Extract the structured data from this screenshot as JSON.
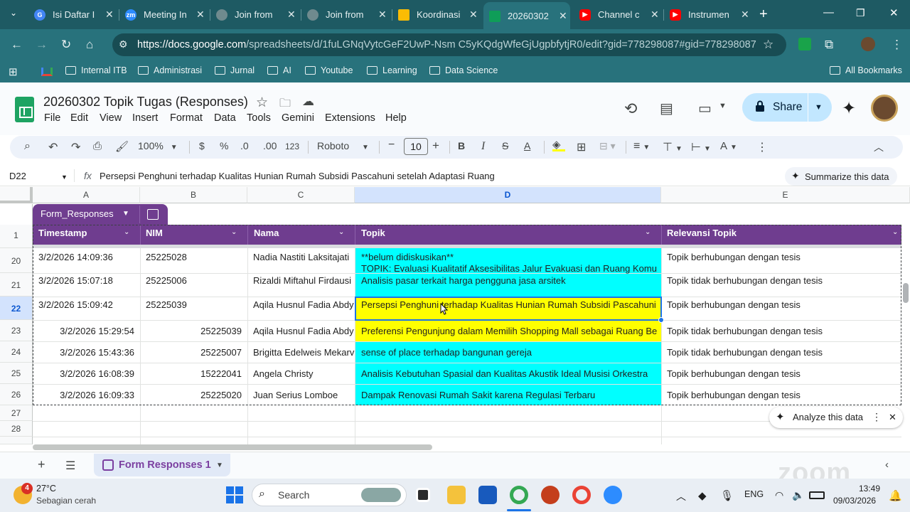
{
  "browser": {
    "tabs": [
      {
        "title": "Isi Daftar I",
        "favicon_color": "#4285f4"
      },
      {
        "title": "Meeting In",
        "favicon_color": "#2d8cff"
      },
      {
        "title": "Join from",
        "favicon_color": "#9aa0a6"
      },
      {
        "title": "Join from",
        "favicon_color": "#9aa0a6"
      },
      {
        "title": "Koordinasi",
        "favicon_color": "#fbbc04"
      },
      {
        "title": "20260302",
        "favicon_color": "#0f9d58",
        "active": true
      },
      {
        "title": "Channel c",
        "favicon_color": "#ff0000"
      },
      {
        "title": "Instrumen",
        "favicon_color": "#ff0000"
      }
    ],
    "url_host": "https://docs.google.com",
    "url_path": "/spreadsheets/d/1fuLGNqVytcGeF2UwP-Nsm C5yKQdgWfeGjUgpbfytjR0/edit?gid=778298087#gid=778298087",
    "bookmarks": [
      "Internal ITB",
      "Administrasi",
      "Jurnal",
      "AI",
      "Youtube",
      "Learning",
      "Data Science"
    ],
    "all_bookmarks": "All Bookmarks"
  },
  "doc": {
    "title": "20260302 Topik Tugas (Responses)",
    "menu": [
      "File",
      "Edit",
      "View",
      "Insert",
      "Format",
      "Data",
      "Tools",
      "Gemini",
      "Extensions",
      "Help"
    ],
    "share_label": "Share"
  },
  "toolbar": {
    "zoom": "100%",
    "currency": "$",
    "percent": "%",
    "dec_less": ".0",
    "dec_more": ".00",
    "format_123": "123",
    "font": "Roboto",
    "font_size": "10"
  },
  "formula": {
    "name_box": "D22",
    "content": "Persepsi Penghuni terhadap Kualitas Hunian Rumah Subsidi Pascahuni setelah Adaptasi Ruang",
    "summarize": "Summarize this data"
  },
  "grid": {
    "columns": [
      "A",
      "B",
      "C",
      "D",
      "E"
    ],
    "table_name": "Form_Responses",
    "headers": [
      "Timestamp",
      "NIM",
      "Nama",
      "Topik",
      "Relevansi Topik"
    ],
    "header_row_num": "1",
    "rows": [
      {
        "num": "20",
        "timestamp": "3/2/2026 14:09:36",
        "nim": "25225028",
        "nama": "Nadia Nastiti Laksitajati",
        "topik": "**belum didiskusikan**",
        "topik2": "TOPIK: Evaluasi Kualitatif Aksesibilitas Jalur Evakuasi dan Ruang Komu",
        "relevansi": "Topik berhubungan dengan tesis"
      },
      {
        "num": "21",
        "timestamp": "3/2/2026 15:07:18",
        "nim": "25225006",
        "nama": "Rizaldi Miftahul Firdausi",
        "topik": "Analisis pasar terkait harga pengguna jasa arsitek",
        "relevansi": "Topik tidak berhubungan dengan tesis"
      },
      {
        "num": "22",
        "timestamp": "3/2/2026 15:09:42",
        "nim": "25225039",
        "nama": "Aqila Husnul Fadia Abdy",
        "topik": "Persepsi Penghuni terhadap Kualitas Hunian Rumah Subsidi Pascahuni",
        "relevansi": "Topik berhubungan dengan tesis"
      },
      {
        "num": "23",
        "timestamp": "3/2/2026 15:29:54",
        "nim": "25225039",
        "nama": "Aqila Husnul Fadia Abdy",
        "topik": "Preferensi Pengunjung dalam Memilih Shopping Mall sebagai Ruang Be",
        "relevansi": "Topik tidak berhubungan dengan tesis"
      },
      {
        "num": "24",
        "timestamp": "3/2/2026 15:43:36",
        "nim": "25225007",
        "nama": "Brigitta Edelweis Mekarv",
        "topik": "sense of place terhadap bangunan gereja",
        "relevansi": "Topik tidak berhubungan dengan tesis"
      },
      {
        "num": "25",
        "timestamp": "3/2/2026 16:08:39",
        "nim": "15222041",
        "nama": "Angela Christy",
        "topik": "Analisis Kebutuhan Spasial dan Kualitas Akustik Ideal Musisi Orkestra",
        "relevansi": "Topik berhubungan dengan tesis"
      },
      {
        "num": "26",
        "timestamp": "3/2/2026 16:09:33",
        "nim": "25225020",
        "nama": "Juan Serius Lomboe",
        "topik": "Dampak Renovasi Rumah Sakit karena Regulasi Terbaru",
        "relevansi": "Topik berhubungan dengan tesis"
      }
    ],
    "empty_rows": [
      "27",
      "28"
    ],
    "analyze": "Analyze this data"
  },
  "sheets": {
    "active_tab": "Form Responses 1"
  },
  "colors": {
    "cyan": "#00ffff",
    "yellow": "#ffff00",
    "table_purple": "#6f3d8f",
    "chrome_teal": "#28727c"
  },
  "taskbar": {
    "weather_temp": "27°C",
    "weather_desc": "Sebagian cerah",
    "weather_badge": "4",
    "search": "Search",
    "lang": "ENG",
    "time": "13:49",
    "date": "09/03/2026",
    "watermark": "zoom"
  }
}
